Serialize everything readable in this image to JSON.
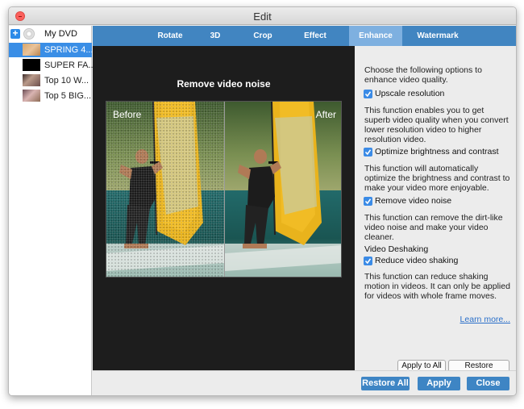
{
  "window": {
    "title": "Edit"
  },
  "sidebar": {
    "root_label": "My DVD",
    "items": [
      {
        "label": "SPRING 4..."
      },
      {
        "label": "SUPER FA..."
      },
      {
        "label": "Top 10 W..."
      },
      {
        "label": "Top 5 BIG..."
      }
    ],
    "selected_index": 0
  },
  "tabs": [
    {
      "label": "Rotate"
    },
    {
      "label": "3D"
    },
    {
      "label": "Crop"
    },
    {
      "label": "Effect"
    },
    {
      "label": "Enhance"
    },
    {
      "label": "Watermark"
    }
  ],
  "active_tab": "Enhance",
  "preview": {
    "title": "Remove video noise",
    "before_label": "Before",
    "after_label": "After"
  },
  "options": {
    "intro": "Choose the following options to enhance video quality.",
    "upscale": {
      "label": "Upscale resolution",
      "checked": true,
      "desc": "This function enables you to get superb video quality when you convert lower resolution video to higher resolution video."
    },
    "brightness": {
      "label": "Optimize brightness and contrast",
      "checked": true,
      "desc": "This function will automatically optimize the brightness and contrast to make your video more enjoyable."
    },
    "noise": {
      "label": "Remove video noise",
      "checked": true,
      "desc": "This function can remove the dirt-like video noise and make your video cleaner."
    },
    "deshake_heading": "Video Deshaking",
    "shaking": {
      "label": "Reduce video shaking",
      "checked": true,
      "desc": "This function can reduce shaking motion in videos. It can only be applied for videos with whole frame moves."
    },
    "learn_more": "Learn more...",
    "apply_to_all": "Apply to All",
    "restore_defaults": "Restore Defaults"
  },
  "footer": {
    "restore_all": "Restore All",
    "apply": "Apply",
    "close": "Close"
  },
  "colors": {
    "accent": "#3a8ee6",
    "tabbar": "#4185c1",
    "active_tab": "#7eb0e0",
    "link": "#2a6fc9"
  }
}
